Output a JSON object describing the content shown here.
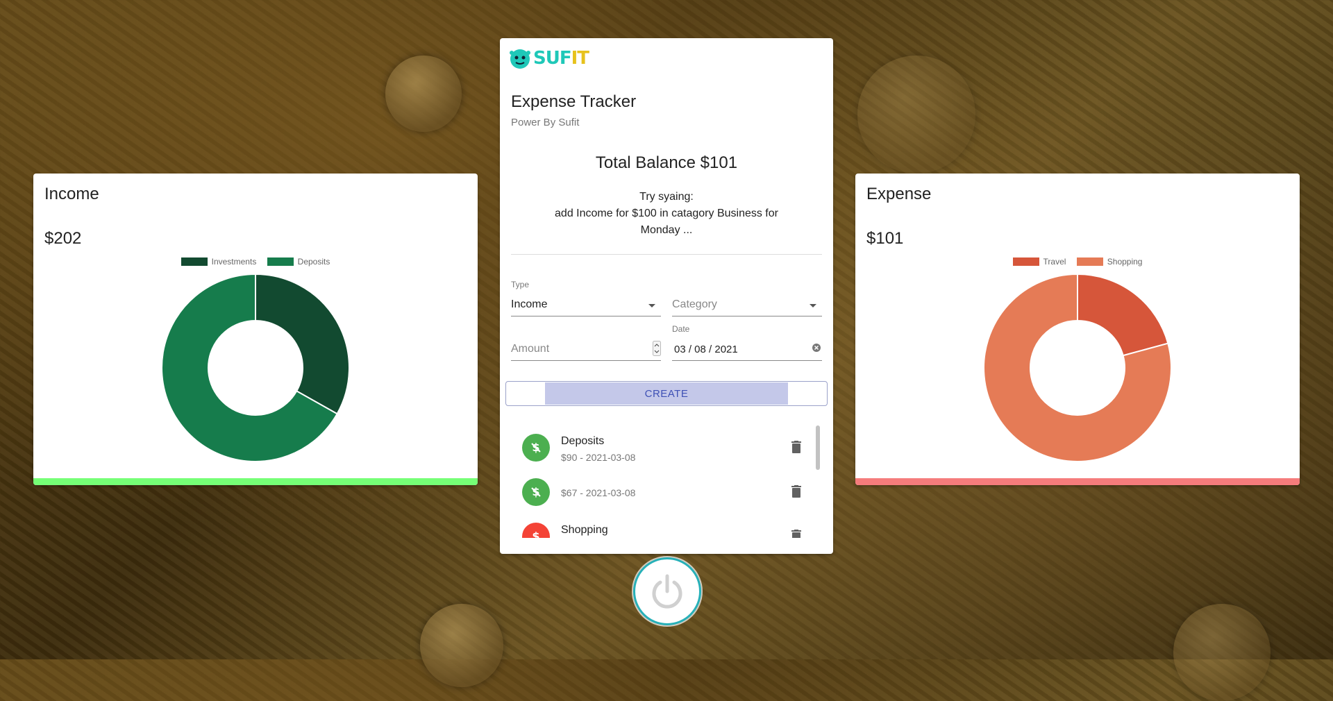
{
  "income": {
    "title": "Income",
    "amount": "$202",
    "bar_color": "#76ff76",
    "chart_data": {
      "type": "pie",
      "categories": [
        "Investments",
        "Deposits"
      ],
      "values": [
        67,
        135
      ],
      "colors": [
        "#124a30",
        "#167c4c"
      ]
    }
  },
  "expense": {
    "title": "Expense",
    "amount": "$101",
    "bar_color": "#f57c7c",
    "chart_data": {
      "type": "pie",
      "categories": [
        "Travel",
        "Shopping"
      ],
      "values": [
        21,
        80
      ],
      "colors": [
        "#d6563a",
        "#e57b56"
      ]
    }
  },
  "main": {
    "logo": {
      "part1": "SUF",
      "part2": "IT"
    },
    "title": "Expense Tracker",
    "subtitle": "Power By Sufit",
    "balance": "Total Balance $101",
    "hint_line1": "Try syaing:",
    "hint_line2": "add Income for $100 in catagory Business for Monday ...",
    "form": {
      "type_label": "Type",
      "type_value": "Income",
      "category_placeholder": "Category",
      "amount_placeholder": "Amount",
      "date_label": "Date",
      "date_value": "03 / 08 / 2021",
      "create_label": "CREATE"
    },
    "transactions": [
      {
        "title": "Deposits",
        "detail": "$90 - 2021-03-08",
        "kind": "income",
        "icon_color": "#4caf50"
      },
      {
        "title": "",
        "detail": "$67 - 2021-03-08",
        "kind": "income",
        "icon_color": "#4caf50"
      },
      {
        "title": "Shopping",
        "detail": "",
        "kind": "expense",
        "icon_color": "#f44336"
      }
    ]
  }
}
